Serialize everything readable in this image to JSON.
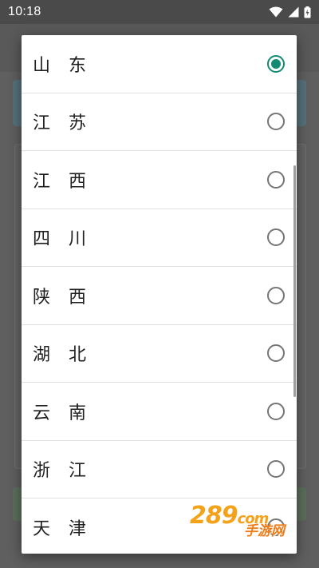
{
  "status_bar": {
    "time": "10:18",
    "icons": [
      "wifi-icon",
      "signal-icon",
      "battery-charging-icon"
    ]
  },
  "dialog": {
    "selected_index": 0,
    "options": [
      {
        "label": "山 东",
        "selected": true
      },
      {
        "label": "江 苏",
        "selected": false
      },
      {
        "label": "江 西",
        "selected": false
      },
      {
        "label": "四 川",
        "selected": false
      },
      {
        "label": "陕 西",
        "selected": false
      },
      {
        "label": "湖 北",
        "selected": false
      },
      {
        "label": "云 南",
        "selected": false
      },
      {
        "label": "浙 江",
        "selected": false
      },
      {
        "label": "天 津",
        "selected": false
      }
    ]
  },
  "watermark": {
    "digits": "289",
    "suffix": "com",
    "text": "手游网"
  },
  "colors": {
    "accent": "#138a72",
    "radio_unchecked": "#757575",
    "scrim": "#5f5f5f",
    "watermark": "#f5a21b"
  }
}
